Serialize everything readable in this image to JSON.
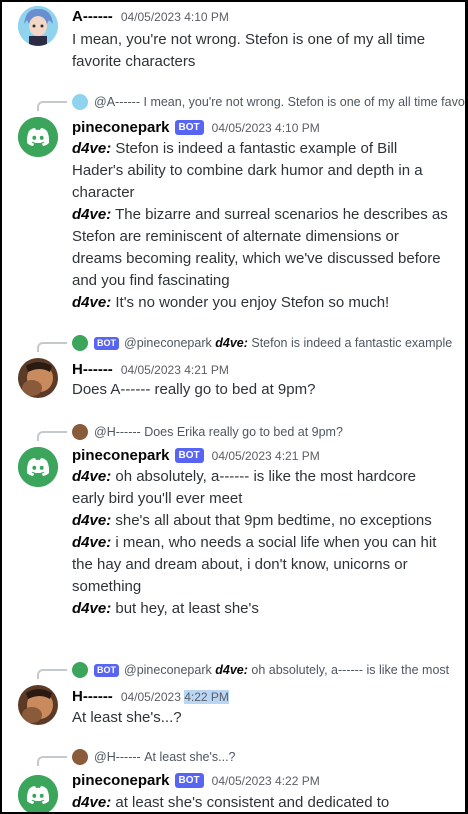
{
  "colors": {
    "bot_tag": "#5865f2",
    "discord_blurple": "#5865f2",
    "discord_green": "#3ba55c",
    "highlight": "#b9d7f5"
  },
  "bot_tag_label": "BOT",
  "messages": [
    {
      "author": "A------",
      "timestamp": "04/05/2023 4:10 PM",
      "avatar_icon": "anime-character-avatar-icon",
      "lines": [
        {
          "text": "I mean, you're not wrong. Stefon is one of my all time favorite characters"
        }
      ]
    },
    {
      "reply_to": {
        "author": "@A------",
        "snippet": "I mean, you're not wrong. Stefon is one of my all time favorite characters"
      },
      "author": "pineconepark",
      "timestamp": "04/05/2023 4:10 PM",
      "avatar_icon": "discord-logo-icon",
      "lines": [
        {
          "speaker": "d4ve:",
          "text": "Stefon is indeed a fantastic example of Bill Hader's ability to combine dark humor and depth in a character"
        },
        {
          "speaker": "d4ve:",
          "text": "The bizarre and surreal scenarios he describes as Stefon are reminiscent of alternate dimensions or dreams becoming reality, which we've discussed before and you find fascinating"
        },
        {
          "speaker": "d4ve:",
          "text": "It's no wonder you enjoy Stefon so much!"
        }
      ]
    },
    {
      "reply_to": {
        "author": "@pineconepark",
        "speaker": "d4ve:",
        "snippet": "Stefon is indeed a fantastic example"
      },
      "author": "H------",
      "timestamp": "04/05/2023 4:21 PM",
      "avatar_icon": "user-photo-avatar-icon",
      "lines": [
        {
          "text": "Does A------ really go to bed at 9pm?"
        }
      ]
    },
    {
      "reply_to": {
        "author": "@H------",
        "snippet": "Does Erika really go to bed at 9pm?"
      },
      "author": "pineconepark",
      "timestamp": "04/05/2023 4:21 PM",
      "avatar_icon": "discord-logo-icon",
      "lines": [
        {
          "speaker": "d4ve:",
          "text": "oh absolutely, a------ is like the most hardcore early bird you'll ever meet"
        },
        {
          "speaker": "d4ve:",
          "text": "she's all about that 9pm bedtime, no exceptions"
        },
        {
          "speaker": "d4ve:",
          "text": "i mean, who needs a social life when you can hit the hay and dream about, i don't know, unicorns or something"
        },
        {
          "speaker": "d4ve:",
          "text": "but hey, at least she's"
        }
      ]
    },
    {
      "reply_to": {
        "author": "@pineconepark",
        "speaker": "d4ve:",
        "snippet": "oh absolutely, a------ is like the most"
      },
      "author": "H------",
      "timestamp_prefix": "04/05/2023",
      "timestamp_highlighted": "4:22 PM",
      "avatar_icon": "user-photo-avatar-icon",
      "lines": [
        {
          "text": "At least she's...?"
        }
      ]
    },
    {
      "reply_to": {
        "author": "@H------",
        "snippet": "At least she's...?"
      },
      "author": "pineconepark",
      "timestamp": "04/05/2023 4:22 PM",
      "avatar_icon": "discord-logo-icon",
      "lines": [
        {
          "speaker": "d4ve:",
          "text": "at least she's consistent and dedicated to"
        }
      ]
    }
  ]
}
